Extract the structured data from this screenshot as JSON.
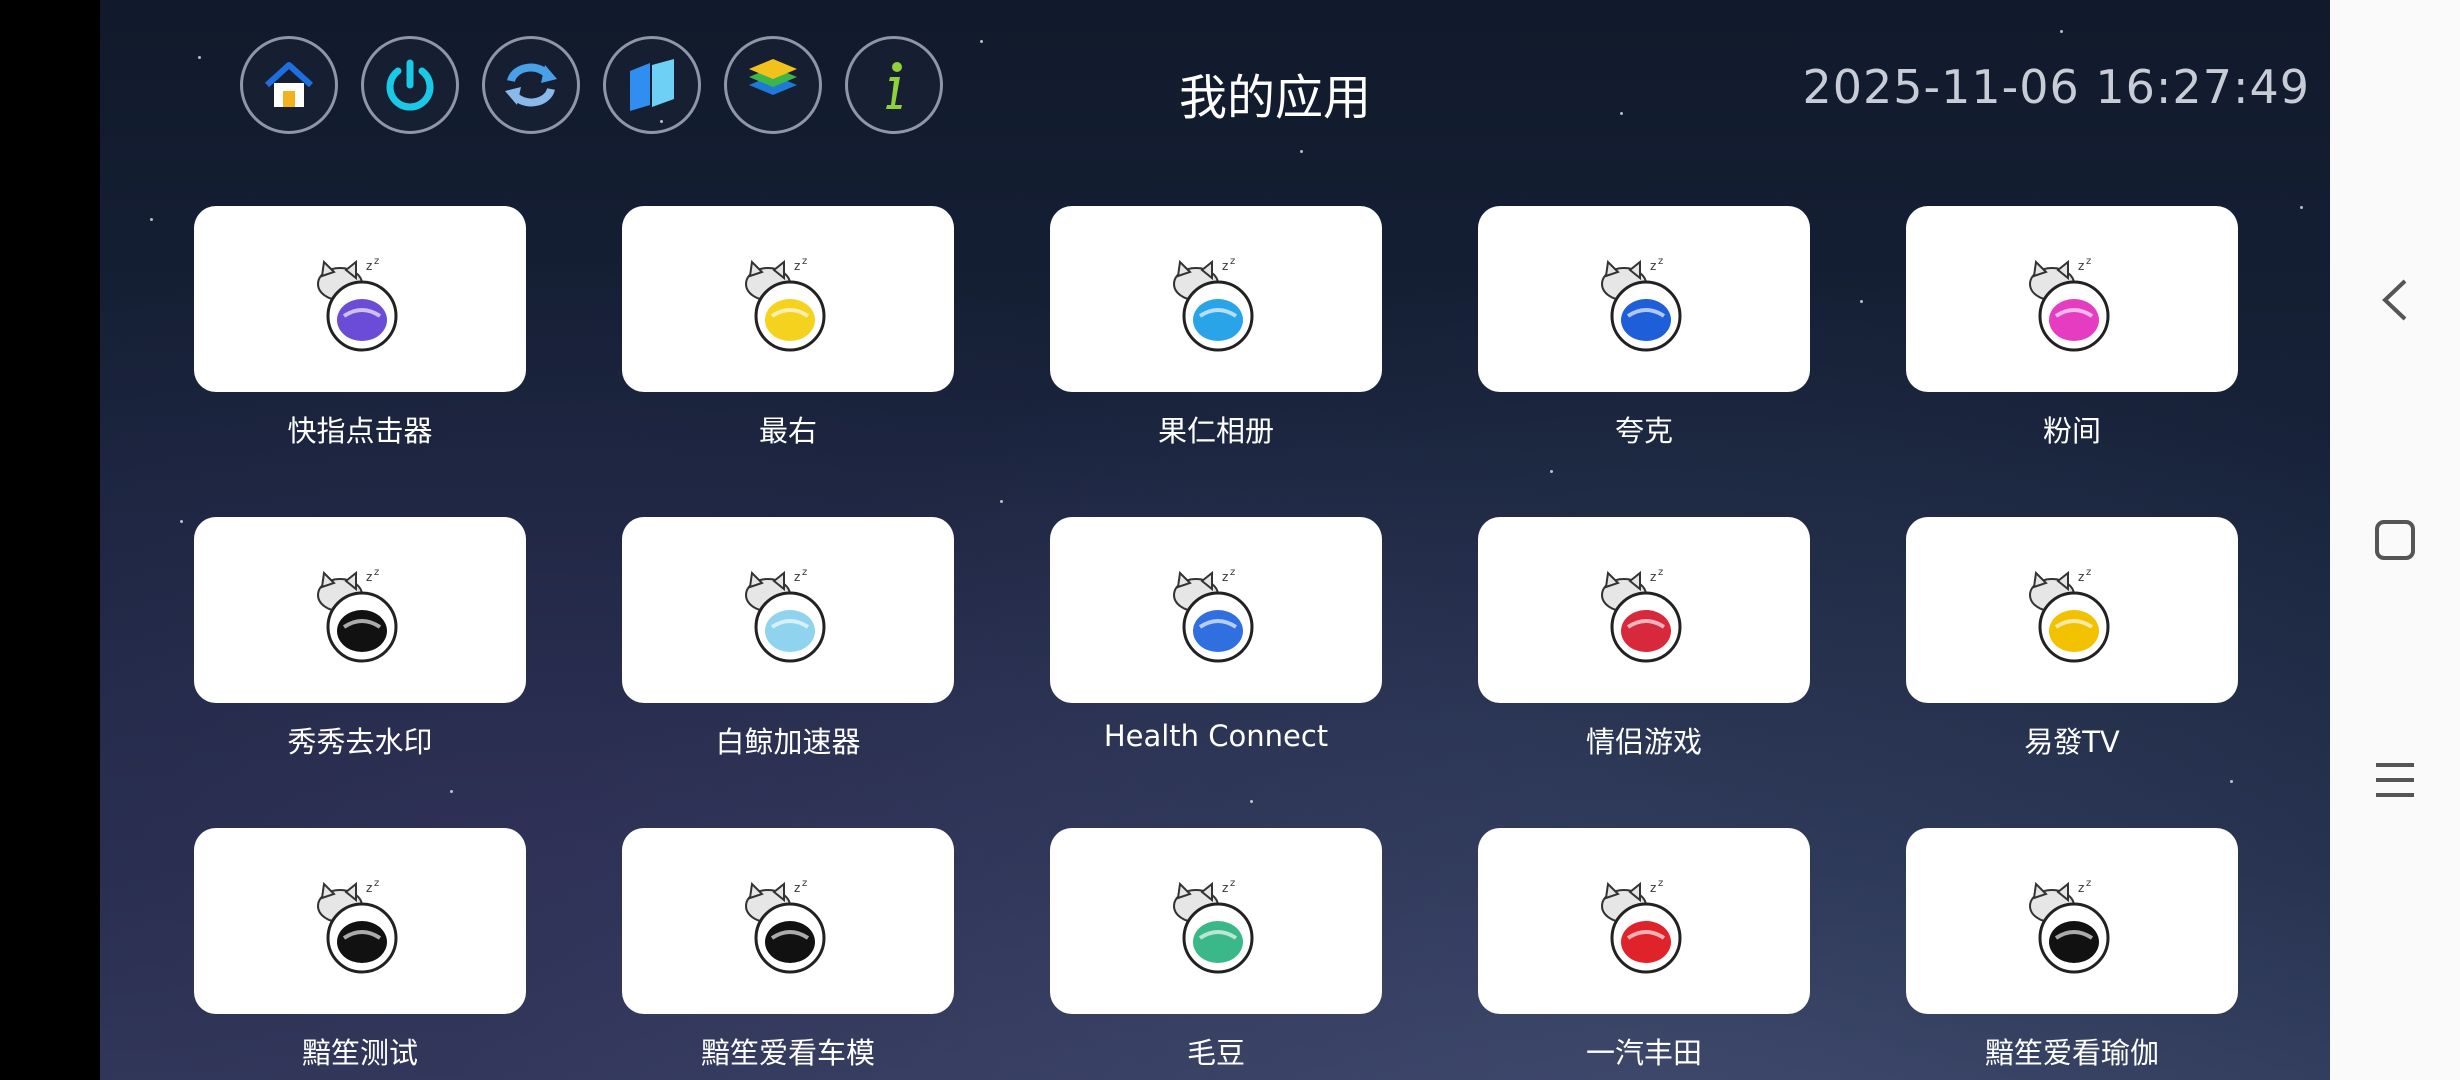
{
  "page_title": "我的应用",
  "datetime": "2025-11-06 16:27:49",
  "toolbar": [
    {
      "icon": "home-icon"
    },
    {
      "icon": "power-icon"
    },
    {
      "icon": "refresh-icon"
    },
    {
      "icon": "panels-icon"
    },
    {
      "icon": "layers-icon"
    },
    {
      "icon": "info-icon"
    }
  ],
  "apps": [
    {
      "label": "快指点击器",
      "accent": "#6a4cd6"
    },
    {
      "label": "最右",
      "accent": "#f5d21e"
    },
    {
      "label": "果仁相册",
      "accent": "#2aa4e8"
    },
    {
      "label": "夸克",
      "accent": "#1f5ed9"
    },
    {
      "label": "粉间",
      "accent": "#e63cc2"
    },
    {
      "label": "秀秀去水印",
      "accent": "#111111"
    },
    {
      "label": "白鲸加速器",
      "accent": "#8fd3ef"
    },
    {
      "label": "Health Connect",
      "accent": "#2f6fe0"
    },
    {
      "label": "情侣游戏",
      "accent": "#d8283c"
    },
    {
      "label": "易發TV",
      "accent": "#f2c200"
    },
    {
      "label": "黯笙测试",
      "accent": "#111111"
    },
    {
      "label": "黯笙爱看车模",
      "accent": "#111111"
    },
    {
      "label": "毛豆",
      "accent": "#3bb88a"
    },
    {
      "label": "一汽丰田",
      "accent": "#e0222a"
    },
    {
      "label": "黯笙爱看瑜伽",
      "accent": "#111111"
    }
  ],
  "nav": [
    {
      "icon": "back-icon"
    },
    {
      "icon": "home-square-icon"
    },
    {
      "icon": "recents-icon"
    }
  ]
}
